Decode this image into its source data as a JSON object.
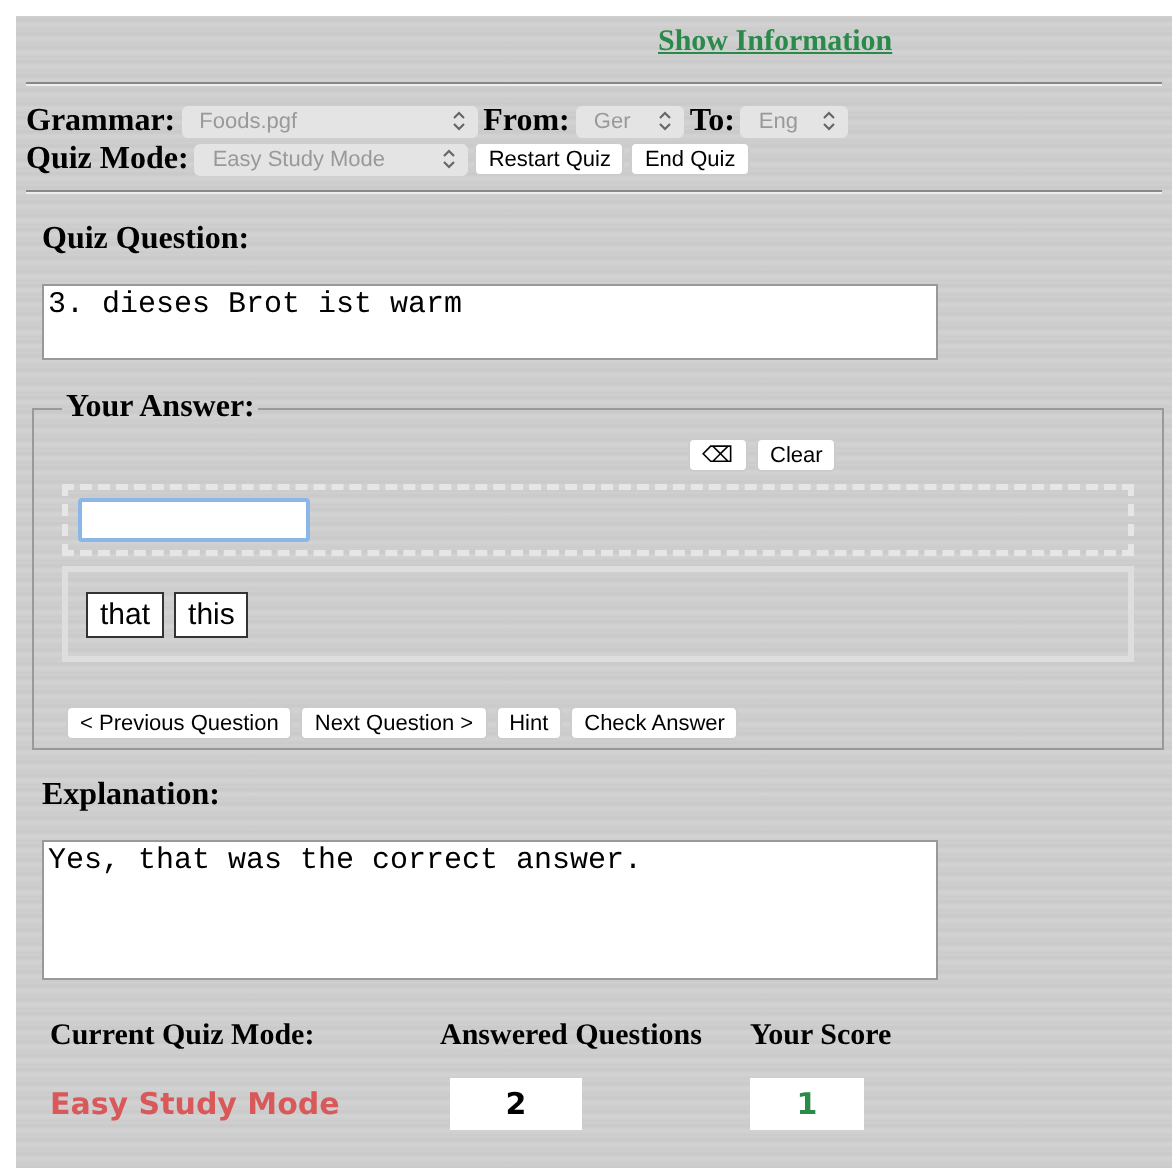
{
  "info_link": "Show Information",
  "settings": [
    {
      "label": "Grammar:",
      "value": "Foods.pgf",
      "disabled": true
    },
    {
      "label": "From:",
      "value": "Ger",
      "disabled": true
    },
    {
      "label": "To:",
      "value": "Eng",
      "disabled": true
    }
  ],
  "quiz_mode": {
    "label": "Quiz Mode:",
    "value": "Easy Study Mode",
    "disabled": true
  },
  "quiz_buttons": [
    "Restart Quiz",
    "End Quiz"
  ],
  "question": {
    "label": "Quiz Question:",
    "text": "3. dieses Brot ist warm"
  },
  "answer": {
    "legend": "Your Answer:",
    "backspace": "⌫",
    "clear": "Clear",
    "words": [
      "that",
      "this"
    ]
  },
  "nav_buttons": [
    "< Previous Question",
    "Next Question >",
    "Hint",
    "Check Answer"
  ],
  "explanation": {
    "label": "Explanation:",
    "text": "Yes, that was the correct answer."
  },
  "stats": {
    "mode_label": "Current Quiz Mode:",
    "answered_label": "Answered Questions",
    "score_label": "Your Score",
    "mode": "Easy Study Mode",
    "answered": "2",
    "score": "1"
  }
}
